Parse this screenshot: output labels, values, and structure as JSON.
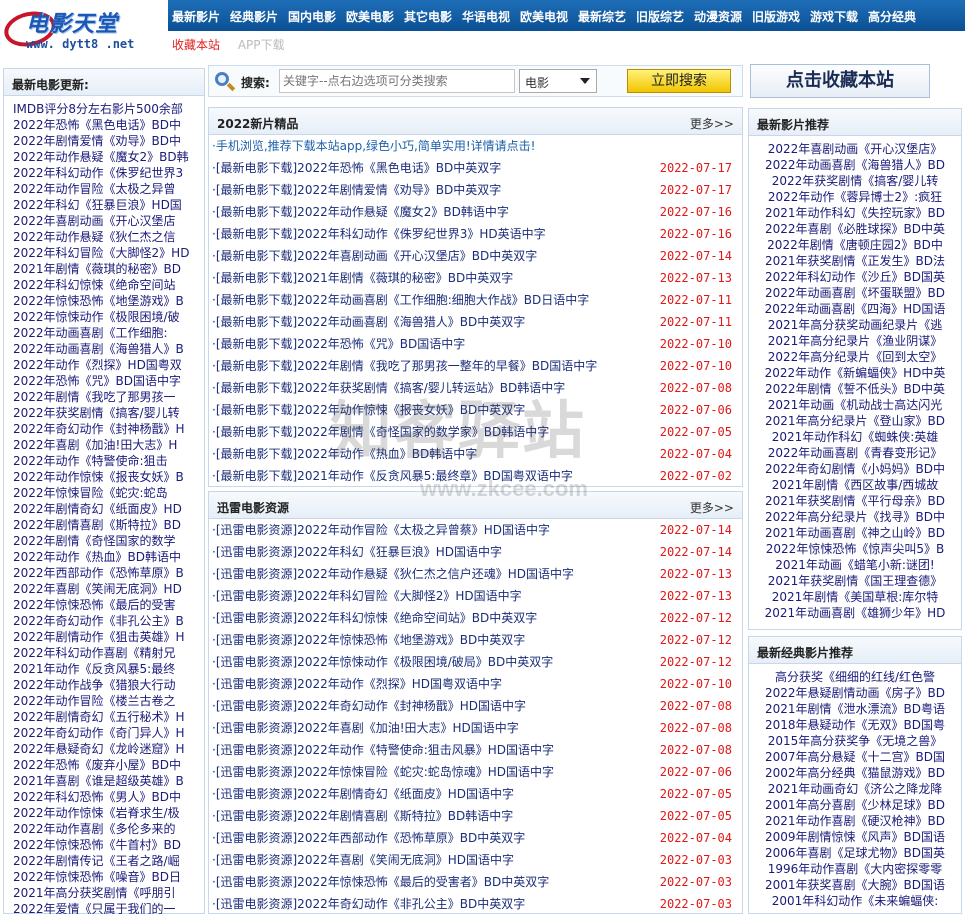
{
  "logo": {
    "title": "电影天堂",
    "url": "www. dytt8 .net"
  },
  "nav": [
    "最新影片",
    "经典影片",
    "国内电影",
    "欧美电影",
    "其它电影",
    "华语电视",
    "欧美电视",
    "最新综艺",
    "旧版综艺",
    "动漫资源",
    "旧版游戏",
    "游戏下载",
    "高分经典"
  ],
  "subnav": [
    "收藏本站",
    "APP下载"
  ],
  "search": {
    "label": "搜索:",
    "placeholder": "关键字--点右边选项可分类搜索",
    "category": "电影",
    "button": "立即搜索"
  },
  "bookmark": "点击收藏本站",
  "left": {
    "title": "最新电影更新:",
    "items": [
      "IMDB评分8分左右影片500余部",
      "2022年恐怖《黑色电话》BD中",
      "2022年剧情爱情《劝导》BD中",
      "2022年动作悬疑《魔女2》BD韩",
      "2022年科幻动作《侏罗纪世界3",
      "2022年动作冒险《太极之异曾",
      "2022年科幻《狂暴巨浪》HD国",
      "2022年喜剧动画《开心汉堡店",
      "2022年动作悬疑《狄仁杰之信",
      "2022年科幻冒险《大脚怪2》HD",
      "2021年剧情《薇琪的秘密》BD",
      "2022年科幻惊悚《绝命空间站",
      "2022年惊悚恐怖《地堡游戏》B",
      "2022年惊悚动作《极限困境/破",
      "2022年动画喜剧《工作细胞:",
      "2022年动画喜剧《海兽猎人》B",
      "2022年动作《烈探》HD国粤双",
      "2022年恐怖《咒》BD国语中字",
      "2022年剧情《我吃了那男孩一",
      "2022年获奖剧情《搞客/婴儿转",
      "2022年奇幻动作《封神杨戬》H",
      "2022年喜剧《加油!田大志》H",
      "2022年动作《特警使命:狙击",
      "2022年动作惊悚《报丧女妖》B",
      "2022年惊悚冒险《蛇灾:蛇岛",
      "2022年剧情奇幻《纸面皮》HD",
      "2022年剧情喜剧《斯特拉》BD",
      "2022年剧情《奇怪国家的数学",
      "2022年动作《热血》BD韩语中",
      "2022年西部动作《恐怖草原》B",
      "2022年喜剧《笑闹无底洞》HD",
      "2022年惊悚恐怖《最后的受害",
      "2022年奇幻动作《非孔公主》B",
      "2022年剧情动作《狙击英雄》H",
      "2022年科幻动作喜剧《精射兄",
      "2021年动作《反贪风暴5:最终",
      "2022年动作战争《猎狼大行动",
      "2022年动作冒险《楼兰古卷之",
      "2022年剧情奇幻《五行秘术》H",
      "2022年奇幻动作《奇门异人》H",
      "2022年悬疑奇幻《龙岭迷窟》H",
      "2022年恐怖《废弃小屋》BD中",
      "2021年喜剧《谁是超级英雄》B",
      "2022年科幻恐怖《男人》BD中",
      "2022年动作惊悚《岩脊求生/极",
      "2022年动作喜剧《多伦多来的",
      "2022年惊悚恐怖《牛首村》BD",
      "2022年剧情传记《王者之路/崛",
      "2022年惊悚恐怖《噪音》BD日",
      "2021年高分获奖剧情《呼朋引",
      "2022年爱情《只属于我们的一"
    ]
  },
  "new_releases": {
    "title": "2022新片精品",
    "more": "更多>>",
    "promo": "·手机浏览,推荐下载本站app,绿色小巧,简单实用!详情请点击!",
    "items": [
      {
        "text": "·[最新电影下载]2022年恐怖《黑色电话》BD中英双字",
        "date": "2022-07-17"
      },
      {
        "text": "·[最新电影下载]2022年剧情爱情《劝导》BD中英双字",
        "date": "2022-07-17"
      },
      {
        "text": "·[最新电影下载]2022年动作悬疑《魔女2》BD韩语中字",
        "date": "2022-07-16"
      },
      {
        "text": "·[最新电影下载]2022年科幻动作《侏罗纪世界3》HD英语中字",
        "date": "2022-07-16"
      },
      {
        "text": "·[最新电影下载]2022年喜剧动画《开心汉堡店》BD中英双字",
        "date": "2022-07-14"
      },
      {
        "text": "·[最新电影下载]2021年剧情《薇琪的秘密》BD中英双字",
        "date": "2022-07-13"
      },
      {
        "text": "·[最新电影下载]2022年动画喜剧《工作细胞:细胞大作战》BD日语中字",
        "date": "2022-07-11"
      },
      {
        "text": "·[最新电影下载]2022年动画喜剧《海兽猎人》BD中英双字",
        "date": "2022-07-11"
      },
      {
        "text": "·[最新电影下载]2022年恐怖《咒》BD国语中字",
        "date": "2022-07-10"
      },
      {
        "text": "·[最新电影下载]2022年剧情《我吃了那男孩一整年的早餐》BD国语中字",
        "date": "2022-07-10"
      },
      {
        "text": "·[最新电影下载]2022年获奖剧情《搞客/婴儿转运站》BD韩语中字",
        "date": "2022-07-08"
      },
      {
        "text": "·[最新电影下载]2022年动作惊悚《报丧女妖》BD中英双字",
        "date": "2022-07-06"
      },
      {
        "text": "·[最新电影下载]2022年剧情《奇怪国家的数学家》BD韩语中字",
        "date": "2022-07-05"
      },
      {
        "text": "·[最新电影下载]2022年动作《热血》BD韩语中字",
        "date": "2022-07-04"
      },
      {
        "text": "·[最新电影下载]2021年动作《反贪风暴5:最终章》BD国粤双语中字",
        "date": "2022-07-02"
      }
    ]
  },
  "thunder": {
    "title": "迅雷电影资源",
    "more": "更多>>",
    "items": [
      {
        "text": "·[迅雷电影资源]2022年动作冒险《太极之异曾蔡》HD国语中字",
        "date": "2022-07-14"
      },
      {
        "text": "·[迅雷电影资源]2022年科幻《狂暴巨浪》HD国语中字",
        "date": "2022-07-14"
      },
      {
        "text": "·[迅雷电影资源]2022年动作悬疑《狄仁杰之信户还魂》HD国语中字",
        "date": "2022-07-13"
      },
      {
        "text": "·[迅雷电影资源]2022年科幻冒险《大脚怪2》HD国语中字",
        "date": "2022-07-13"
      },
      {
        "text": "·[迅雷电影资源]2022年科幻惊悚《绝命空间站》BD中英双字",
        "date": "2022-07-12"
      },
      {
        "text": "·[迅雷电影资源]2022年惊悚恐怖《地堡游戏》BD中英双字",
        "date": "2022-07-12"
      },
      {
        "text": "·[迅雷电影资源]2022年惊悚动作《极限困境/破局》BD中英双字",
        "date": "2022-07-12"
      },
      {
        "text": "·[迅雷电影资源]2022年动作《烈探》HD国粤双语中字",
        "date": "2022-07-10"
      },
      {
        "text": "·[迅雷电影资源]2022年奇幻动作《封神杨戬》HD国语中字",
        "date": "2022-07-08"
      },
      {
        "text": "·[迅雷电影资源]2022年喜剧《加油!田大志》HD国语中字",
        "date": "2022-07-08"
      },
      {
        "text": "·[迅雷电影资源]2022年动作《特警使命:狙击风暴》HD国语中字",
        "date": "2022-07-08"
      },
      {
        "text": "·[迅雷电影资源]2022年惊悚冒险《蛇灾:蛇岛惊魂》HD国语中字",
        "date": "2022-07-06"
      },
      {
        "text": "·[迅雷电影资源]2022年剧情奇幻《纸面皮》HD国语中字",
        "date": "2022-07-05"
      },
      {
        "text": "·[迅雷电影资源]2022年剧情喜剧《斯特拉》BD韩语中字",
        "date": "2022-07-05"
      },
      {
        "text": "·[迅雷电影资源]2022年西部动作《恐怖草原》BD中英双字",
        "date": "2022-07-04"
      },
      {
        "text": "·[迅雷电影资源]2022年喜剧《笑闹无底洞》HD国语中字",
        "date": "2022-07-03"
      },
      {
        "text": "·[迅雷电影资源]2022年惊悚恐怖《最后的受害者》BD中英双字",
        "date": "2022-07-03"
      },
      {
        "text": "·[迅雷电影资源]2022年奇幻动作《非孔公主》BD中英双字",
        "date": "2022-07-03"
      }
    ]
  },
  "recommend": {
    "title": "最新影片推荐",
    "items": [
      "2022年喜剧动画《开心汉堡店》",
      "2022年动画喜剧《海兽猎人》BD",
      "2022年获奖剧情《搞客/婴儿转",
      "2022年动作《蓉异博士2》:疯狂",
      "2021年动作科幻《失控玩家》BD",
      "2022年喜剧《必胜球探》BD中英",
      "2022年剧情《唐顿庄园2》BD中",
      "2021年获奖剧情《正发生》BD法",
      "2022年科幻动作《沙丘》BD国英",
      "2022年动画喜剧《坏蛋联盟》BD",
      "2022年动画喜剧《四海》HD国语",
      "2021年高分获奖动画纪录片《逃",
      "2021年高分纪录片《渔业阴谋》",
      "2022年高分纪录片《回到太空》",
      "2022年动作《新蝙蝠侠》HD中英",
      "2022年剧情《誓不低头》BD中英",
      "2021年动画《机动战士高达闪光",
      "2021年高分纪录片《登山家》BD",
      "2021年动作科幻《蜘蛛侠:英雄",
      "2022年动画喜剧《青春变形记》",
      "2022年奇幻剧情《小妈妈》BD中",
      "2021年剧情《西区故事/西城故",
      "2021年获奖剧情《平行母亲》BD",
      "2022年高分纪录片《找寻》BD中",
      "2021年动画喜剧《神之山岭》BD",
      "2022年惊悚恐怖《惊声尖叫5》B",
      "2021年动画《蜡笔小新:谜团!",
      "2021年获奖剧情《国王理查德》",
      "2021年剧情《美国草根:库尔特",
      "2021年动画喜剧《雄狮少年》HD"
    ]
  },
  "classic": {
    "title": "最新经典影片推荐",
    "items": [
      "高分获奖《细细的红线/红色警",
      "2022年悬疑剧情动画《房子》BD",
      "2021年剧情《泄水漂流》BD粤语",
      "2018年悬疑动作《无双》BD国粤",
      "2015年高分获奖争《无境之兽》",
      "2007年高分悬疑《十二宫》BD国",
      "2002年高分经典《猫鼠游戏》BD",
      "2021年动画奇幻《济公之降龙降",
      "2001年高分喜剧《少林足球》BD",
      "2021年动作喜剧《硬汉枪神》BD",
      "2009年剧情惊悚《风声》BD国语",
      "2006年喜剧《足球尤物》BD国英",
      "1996年动作喜剧《大内密探零零",
      "2001年获奖喜剧《大腕》BD国语",
      "2001年科幻动作《未来蝙蝠侠:"
    ]
  },
  "watermark": {
    "big": "知客驿站",
    "small": "www.zkcee.com"
  }
}
